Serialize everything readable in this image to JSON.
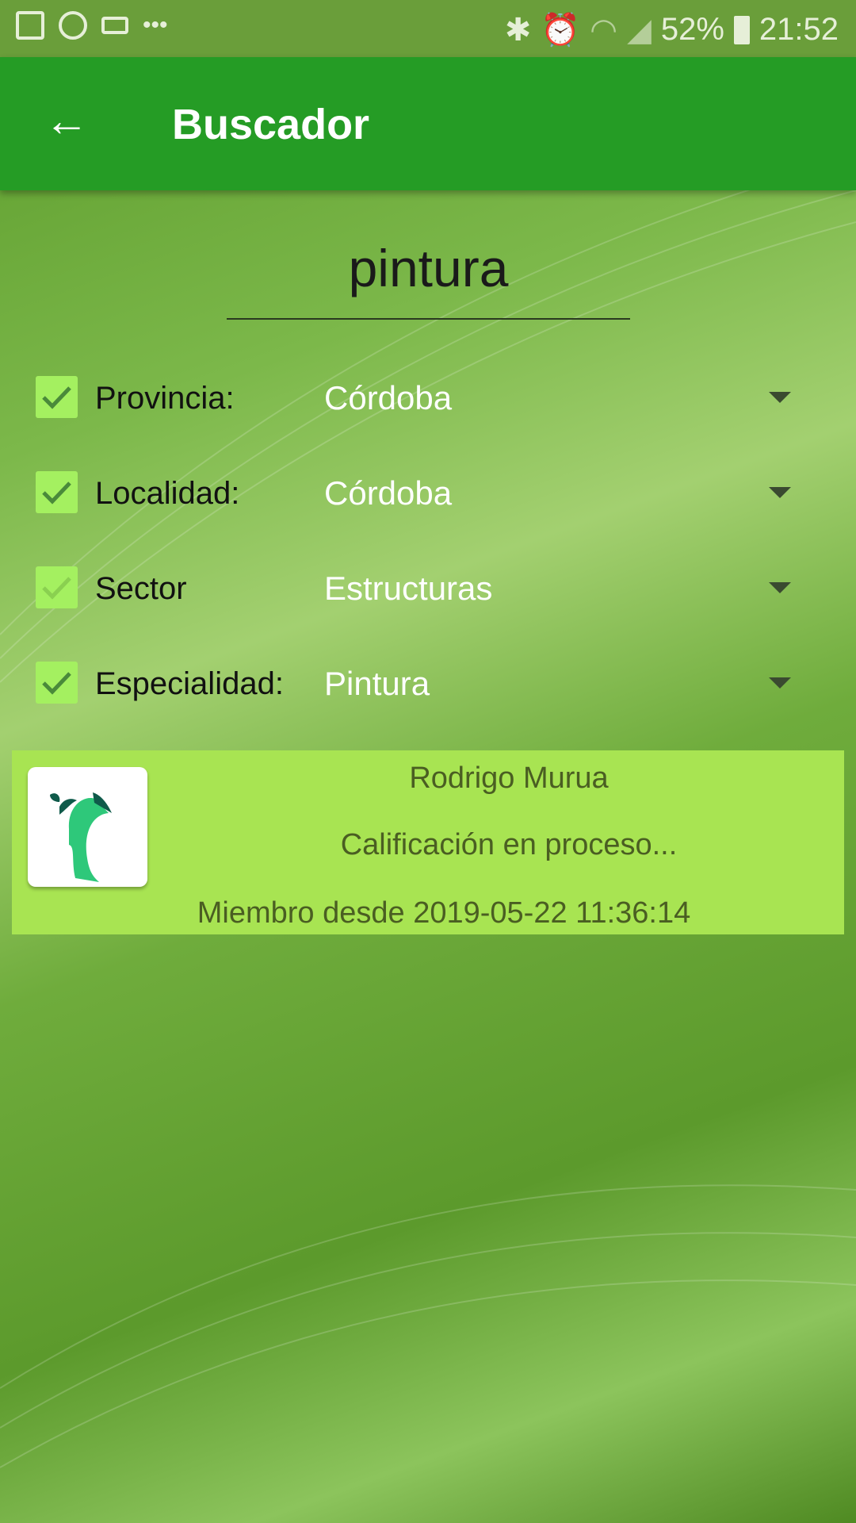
{
  "status_bar": {
    "battery": "52%",
    "time": "21:52",
    "left_icons": [
      "gallery-icon",
      "whatsapp-business-icon",
      "cast-icon",
      "more-icon"
    ],
    "right_icons": [
      "bluetooth-icon",
      "alarm-icon",
      "wifi-icon",
      "signal-icon",
      "battery-icon"
    ]
  },
  "app_bar": {
    "title": "Buscador",
    "back_icon": "arrow-left-icon"
  },
  "search": {
    "value": "pintura"
  },
  "filters": [
    {
      "label": "Provincia:",
      "value": "Córdoba",
      "checked": true
    },
    {
      "label": "Localidad:",
      "value": "Córdoba",
      "checked": true
    },
    {
      "label": "Sector",
      "value": "Estructuras",
      "checked": true
    },
    {
      "label": "Especialidad:",
      "value": "Pintura",
      "checked": true
    }
  ],
  "results": [
    {
      "name": "Rodrigo Murua",
      "rating": "Calificación en proceso...",
      "member_since": "Miembro desde 2019-05-22 11:36:14"
    }
  ],
  "colors": {
    "app_bar": "#259c25",
    "status_bar": "#6a9e3a",
    "card": "#a8e452",
    "checkbox": "#a4f060"
  }
}
